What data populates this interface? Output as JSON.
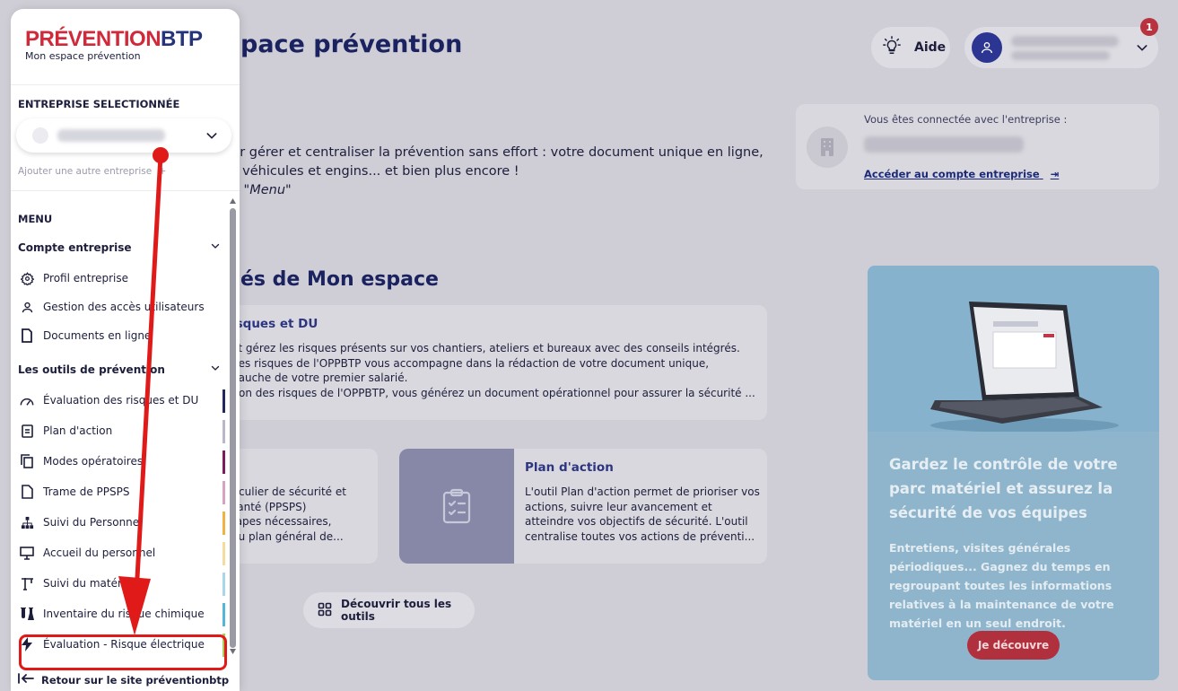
{
  "header": {
    "page_title_partial": "pace prévention",
    "help_label": "Aide",
    "notification_count": "1"
  },
  "intro": {
    "line1": "ur gérer et centraliser la prévention sans effort : votre document unique en ligne,",
    "line2": "s véhicules et engins... et bien plus encore !",
    "line3": "e \"Menu\""
  },
  "company_card": {
    "label": "Vous êtes connectée avec l'entreprise :",
    "link": "Accéder au compte entreprise"
  },
  "section_title_partial": "és de Mon espace",
  "card_du": {
    "title_partial": "isques et DU",
    "lines": [
      "et gérez les risques présents sur vos chantiers, ateliers et bureaux avec des conseils intégrés.",
      "des risques de l'OPPBTP vous accompagne dans la rédaction de votre document unique,",
      "bauche de votre premier salarié.",
      "tion des risques de l'OPPBTP, vous générez un document opérationnel pour assurer la sécurité ..."
    ]
  },
  "card_ppsps": {
    "lines": [
      "ticulier de sécurité et",
      "santé (PPSPS)",
      "tapes nécessaires,",
      "du plan général de..."
    ]
  },
  "card_plan": {
    "title": "Plan d'action",
    "lines": [
      "L'outil Plan d'action permet de prioriser vos",
      "actions, suivre leur avancement et",
      "atteindre vos objectifs de sécurité. L'outil",
      "centralise toutes vos actions de préventi..."
    ]
  },
  "discover_label": "Découvrir tous les outils",
  "promo": {
    "heading": "Gardez le contrôle de votre parc matériel et assurez la sécurité de vos équipes",
    "text": "Entretiens, visites générales périodiques... Gagnez du temps en regroupant toutes les informations relatives à la maintenance de votre matériel en un seul endroit.",
    "button": "Je découvre"
  },
  "sidebar": {
    "logo_red": "PRÉVENTION",
    "logo_navy": "BTP",
    "logo_sub": "Mon espace prévention",
    "entreprise_label": "ENTREPRISE SELECTIONNÉE",
    "add_entreprise": "Ajouter une autre entreprise",
    "menu_label": "MENU",
    "groups": [
      {
        "label": "Compte entreprise"
      },
      {
        "label": "Les outils de prévention"
      }
    ],
    "account_items": [
      {
        "label": "Profil entreprise",
        "icon": "gear-icon"
      },
      {
        "label": "Gestion des accès utilisateurs",
        "icon": "user-icon"
      },
      {
        "label": "Documents en ligne",
        "icon": "document-icon"
      }
    ],
    "tool_items": [
      {
        "label": "Évaluation des risques et DU",
        "icon": "gauge-icon",
        "color": "#23285f"
      },
      {
        "label": "Plan d'action",
        "icon": "clipboard-icon",
        "color": "#b9b7cc"
      },
      {
        "label": "Modes opératoires",
        "icon": "copy-icon",
        "color": "#7a1d5a"
      },
      {
        "label": "Trame de PPSPS",
        "icon": "file-icon",
        "color": "#d6a3c2"
      },
      {
        "label": "Suivi du Personnel",
        "icon": "org-chart-icon",
        "color": "#efb33f"
      },
      {
        "label": "Accueil du personnel",
        "icon": "presentation-icon",
        "color": "#f3dca0"
      },
      {
        "label": "Suivi du matériel",
        "icon": "crane-icon",
        "color": "#a9d6e8"
      },
      {
        "label": "Inventaire du risque chimique",
        "icon": "flask-icon",
        "color": "#52b7d8"
      },
      {
        "label": "Évaluation - Risque électrique",
        "icon": "lightning-icon",
        "color": "#a6cf5b"
      }
    ],
    "back_link": "Retour sur le site préventionbtp"
  },
  "colors": {
    "brand_red": "#d1293a",
    "brand_navy": "#25337b",
    "annotation_red": "#e01919"
  }
}
